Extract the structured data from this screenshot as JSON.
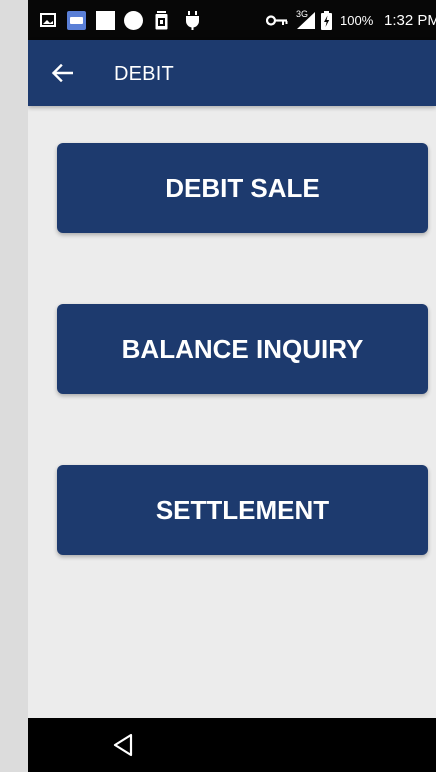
{
  "status_bar": {
    "icons_left": [
      "image-icon",
      "app-badge-icon",
      "square-icon",
      "circle-icon",
      "sim-icon",
      "android-icon"
    ],
    "icons_right": [
      "key-icon",
      "signal-3g-icon",
      "battery-charging-icon"
    ],
    "network_label": "3G",
    "battery": "100%",
    "time": "1:32 PM"
  },
  "app_bar": {
    "title": "DEBIT",
    "back_icon": "arrow-left-icon"
  },
  "actions": [
    {
      "label": "DEBIT SALE"
    },
    {
      "label": "BALANCE INQUIRY"
    },
    {
      "label": "SETTLEMENT"
    }
  ],
  "nav_bar": {
    "back_icon": "triangle-back-icon"
  },
  "colors": {
    "primary": "#1d3a6e",
    "background": "#ececec",
    "status_bar": "#070707",
    "text_on_primary": "#ffffff"
  }
}
